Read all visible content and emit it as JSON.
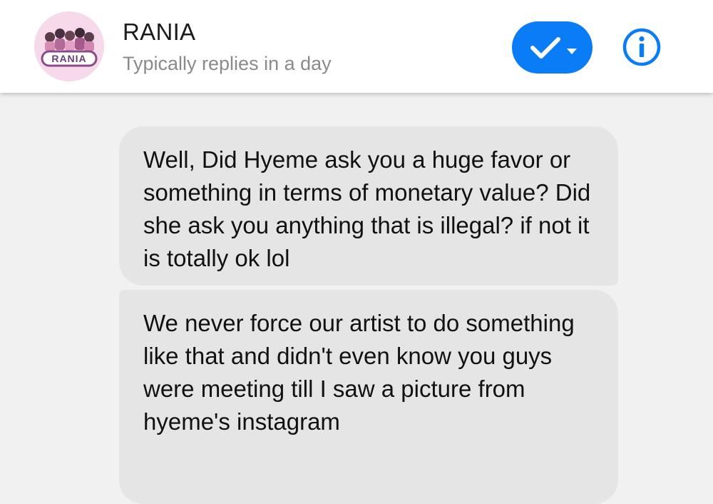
{
  "header": {
    "name": "RANIA",
    "subtitle": "Typically replies in a day",
    "avatar_logo_text": "RANIA"
  },
  "icons": {
    "status_button": "check-icon",
    "status_caret": "chevron-down-icon",
    "info": "info-icon"
  },
  "colors": {
    "accent": "#0a7cf5",
    "bubble": "#e5e5e5",
    "background": "#f1f1f1",
    "avatar_bg": "#f7d9ec"
  },
  "messages": [
    {
      "text": "Well, Did Hyeme ask you a huge favor or something in terms of monetary value? Did she ask you anything that is illegal? if not it is totally ok lol"
    },
    {
      "text": "We never force our artist to do something like that and didn't even know you guys were meeting till I saw a picture from hyeme's instagram"
    }
  ]
}
